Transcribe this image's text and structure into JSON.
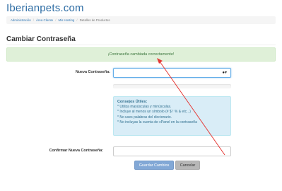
{
  "header": {
    "logo": "Iberianpets.com"
  },
  "breadcrumb": {
    "items": [
      "Administración",
      "Área Cliente",
      "Mis Hosting",
      "Detalles de Productos"
    ]
  },
  "page": {
    "title": "Cambiar Contraseña"
  },
  "alert": {
    "text": "¡Contraseña cambiada correctamente!"
  },
  "form": {
    "new_password_label": "Nueva Contraseña:",
    "new_password_value": "",
    "confirm_password_label": "Confirmar Nueva Contraseña:",
    "confirm_password_value": "",
    "key_icon": "key-icon"
  },
  "tips": {
    "title": "Consejos Útiles:",
    "items": [
      "* Utiliza mayúsculas y minúsculas.",
      "* Incluye al menos un símbolo (# $ ! % & etc...)",
      "* No uses palabras del diccionario.",
      "* No incluyas la cuenta de cPanel en la contraseña"
    ]
  },
  "buttons": {
    "save": "Guardar Cambios",
    "cancel": "Cancelar"
  },
  "colors": {
    "brand": "#2e6da4",
    "success_bg": "#dff0d8",
    "info_bg": "#d9edf7",
    "annotation_arrow": "#e53935"
  }
}
